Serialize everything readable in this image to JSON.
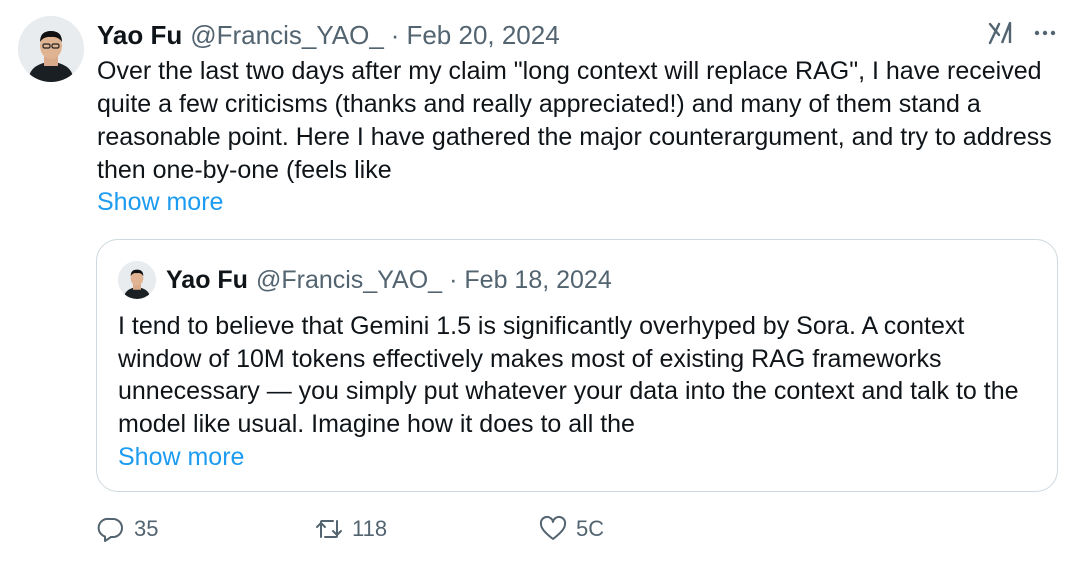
{
  "tweet": {
    "author_name": "Yao Fu",
    "author_handle": "@Francis_YAO_",
    "separator": "·",
    "date": "Feb 20, 2024",
    "text": "Over the last two days after my claim \"long context will replace RAG\", I have received quite a few criticisms (thanks and really appreciated!) and many of them stand a reasonable point. Here I have gathered the major counterargument, and try to address then one-by-one (feels like",
    "show_more": "Show more",
    "top_icons": [
      "grok-icon",
      "more-icon"
    ]
  },
  "quote": {
    "author_name": "Yao Fu",
    "author_handle": "@Francis_YAO_",
    "separator": "·",
    "date": "Feb 18, 2024",
    "text": "I tend to believe that Gemini 1.5 is significantly overhyped by Sora. A context window of 10M tokens effectively makes most of existing RAG frameworks unnecessary — you simply put whatever your data into the context and talk to the model like usual. Imagine how it does to all the",
    "show_more": "Show more"
  },
  "actions": {
    "replies": "35",
    "reposts": "118",
    "likes": "5C"
  },
  "colors": {
    "link": "#1d9bf0",
    "secondary_text": "#536471",
    "border": "#cfd9de"
  }
}
